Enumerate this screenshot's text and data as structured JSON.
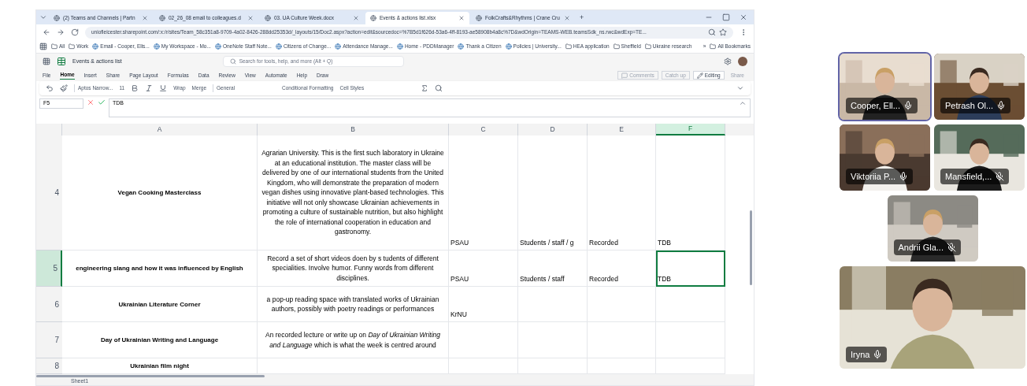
{
  "browser": {
    "tabs": [
      {
        "label": "(2) Teams and Channels | Partn",
        "selected": false
      },
      {
        "label": "02_26_08 email to colleagues.d",
        "selected": false
      },
      {
        "label": "03. UA Culture Week.docx",
        "selected": false
      },
      {
        "label": "Events & actions list.xlsx",
        "selected": true
      },
      {
        "label": "FolkCrafts&Rhythms | Crane Cru",
        "selected": false
      }
    ],
    "new_tab": "+",
    "url": "uniofleicester.sharepoint.com/:x:/r/sites/Team_58c351a8-9709-4a02-8426-288dd25353d/_layouts/15/Doc2.aspx?action=edit&sourcedoc=%7B5d1f626d-53a6-4ff-8193-ae58908b4a8c%7D&wdOrigin=TEAMS-WEB.teamsSdk_ns.rwc&wdExp=TE...",
    "bookmarks": [
      {
        "label": "All",
        "kind": "folder"
      },
      {
        "label": "Work",
        "kind": "folder"
      },
      {
        "label": "Email - Cooper, Elis...",
        "kind": "site"
      },
      {
        "label": "My Workspace - Mo...",
        "kind": "site"
      },
      {
        "label": "OneNote Staff Note...",
        "kind": "site"
      },
      {
        "label": "Citizens of Change...",
        "kind": "site"
      },
      {
        "label": "Attendance Manage...",
        "kind": "site"
      },
      {
        "label": "Home - PDDManager",
        "kind": "site"
      },
      {
        "label": "Thank a Citizen",
        "kind": "site"
      },
      {
        "label": "Policies | University...",
        "kind": "site"
      },
      {
        "label": "HEA application",
        "kind": "folder"
      },
      {
        "label": "Sheffield",
        "kind": "folder"
      },
      {
        "label": "Ukraine research",
        "kind": "folder"
      }
    ],
    "more_bookmarks": "»",
    "all_bookmarks": "All Bookmarks"
  },
  "excel": {
    "file_name": "Events & actions list",
    "search_placeholder": "Search for tools, help, and more (Alt + Q)",
    "menu": [
      {
        "label": "File",
        "selected": false
      },
      {
        "label": "Home",
        "selected": true
      },
      {
        "label": "Insert",
        "selected": false
      },
      {
        "label": "Share",
        "selected": false
      },
      {
        "label": "Page Layout",
        "selected": false
      },
      {
        "label": "Formulas",
        "selected": false
      },
      {
        "label": "Data",
        "selected": false
      },
      {
        "label": "Review",
        "selected": false
      },
      {
        "label": "View",
        "selected": false
      },
      {
        "label": "Automate",
        "selected": false
      },
      {
        "label": "Help",
        "selected": false
      },
      {
        "label": "Draw",
        "selected": false
      }
    ],
    "comments": "Comments",
    "catch_up": "Catch up",
    "editing": "Editing",
    "share": "Share",
    "toolbar": {
      "font": "Aptos Narrow...",
      "size": "11",
      "wrap": "Wrap",
      "merge": "Merge",
      "number_format": "General",
      "conditional_formatting": "Conditional Formatting",
      "cell_styles": "Cell Styles"
    },
    "name_box": "F5",
    "formula": "TDB",
    "columns": [
      {
        "label": "A",
        "selected": false
      },
      {
        "label": "B",
        "selected": false
      },
      {
        "label": "C",
        "selected": false
      },
      {
        "label": "D",
        "selected": false
      },
      {
        "label": "E",
        "selected": false
      },
      {
        "label": "F",
        "selected": true
      }
    ],
    "rows": [
      {
        "number": "4",
        "selected": false,
        "cells": [
          "Vegan Cooking Masterclass",
          "Agrarian University. This is the first such laboratory in Ukraine at an educational institution. The master class will be delivered by one of our international students from the United Kingdom, who will demonstrate the preparation of modern vegan dishes using innovative plant-based technologies. This initiative will not only showcase Ukrainian achievements in promoting a culture of sustainable nutrition, but also highlight the role of international cooperation in education and gastronomy.",
          "PSAU",
          "Students / staff / g",
          "Recorded",
          "TDB"
        ],
        "active": [
          false,
          false,
          false,
          false,
          false,
          false
        ]
      },
      {
        "number": "5",
        "selected": true,
        "cells": [
          "engineering slang and how it was influenced by English",
          "Record a set of short videos doen by s tudents of different specialities. Involve humor. Funny words from different disciplines.",
          "PSAU",
          "Students / staff",
          "Recorded",
          "TDB"
        ],
        "active": [
          false,
          false,
          false,
          false,
          false,
          true
        ]
      },
      {
        "number": "6",
        "selected": false,
        "cells": [
          "Ukrainian Literature Corner",
          "a pop-up reading space with translated works of Ukrainian authors, possibly with poetry readings or performances",
          "KrNU",
          "",
          "",
          ""
        ],
        "active": [
          false,
          false,
          false,
          false,
          false,
          false
        ]
      },
      {
        "number": "7",
        "selected": false,
        "cells": [
          "Day of Ukrainian Writing and Language",
          "An recorded lecture or write up on *Day of Ukrainian Writing and Language* which is what the week is centred around",
          "",
          "",
          "",
          ""
        ],
        "active": [
          false,
          false,
          false,
          false,
          false,
          false
        ]
      },
      {
        "number": "8",
        "selected": false,
        "cells": [
          "Ukrainian film night",
          "",
          "",
          "",
          "",
          ""
        ],
        "active": [
          false,
          false,
          false,
          false,
          false,
          false
        ]
      }
    ],
    "sheet_tab": "Sheet1"
  },
  "participants": [
    {
      "name": "Cooper, Ell...",
      "muted": false,
      "speaking": true
    },
    {
      "name": "Petrash Ol...",
      "muted": false,
      "speaking": false
    },
    {
      "name": "Viktoriia P...",
      "muted": false,
      "speaking": false
    },
    {
      "name": "Mansfield,...",
      "muted": true,
      "speaking": false
    },
    {
      "name": "Andrii Gla...",
      "muted": true,
      "speaking": false
    },
    {
      "name": "Iryna",
      "muted": false,
      "speaking": false
    }
  ]
}
